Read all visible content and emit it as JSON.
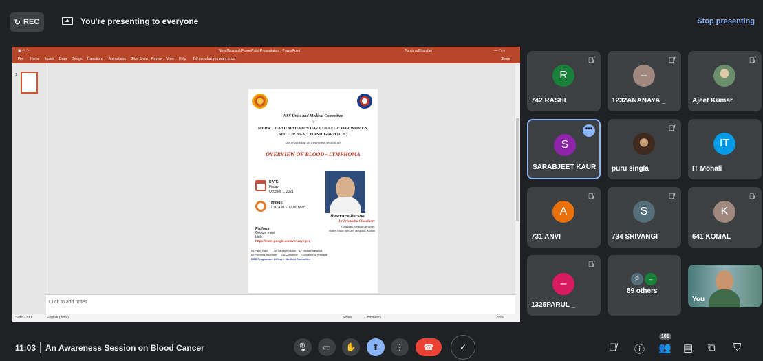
{
  "topbar": {
    "rec_label": "REC",
    "presenting_text": "You're presenting to everyone",
    "stop_label": "Stop presenting"
  },
  "ppt": {
    "window_title": "New Microsoft PowerPoint Presentation - PowerPoint",
    "user_name": "Purnima Bhandari",
    "menu": [
      "File",
      "Home",
      "Insert",
      "Draw",
      "Design",
      "Transitions",
      "Animations",
      "Slide Show",
      "Review",
      "View",
      "Help"
    ],
    "tell_me": "Tell me what you want to do",
    "share": "Share",
    "notes_placeholder": "Click to add notes",
    "status_slide": "Slide 1 of 1",
    "status_lang": "English (India)",
    "status_notes": "Notes",
    "status_comments": "Comments",
    "zoom": "33%"
  },
  "slide": {
    "org": "NSS Units and Medical Committee",
    "of": "of",
    "college": "MEHR CHAND MAHAJAN DAV COLLEGE FOR WOMEN,",
    "sector": "SECTOR 36-A, CHANDIGARH (U.T.)",
    "organising": "are organising an awareness session on",
    "heading": "OVERVIEW OF BLOOD - LYMPHOMA",
    "date_label": "DATE:",
    "date_day": "Friday",
    "date_value": "October 1, 2021",
    "timings_label": "Timings:",
    "timings_value": "11.00 A.M. - 12.00 noon",
    "resource_label": "Resource Person",
    "resource_name": "Dr Priyanshu Choudhary",
    "resource_role": "Consultant Medical Oncology,",
    "resource_org": "Shalby Multi-Specialty Hospitals, Mohali",
    "platform_label": "Platform:",
    "platform_value": "Google meet",
    "link_label": "Link:",
    "link_value": "https://meet.google.com/ver-zeyn-prq",
    "people_line1": "Dr Pallvi Rani        Dr Sarabjeet Kaur    Dr Nisha Bhargava",
    "people_line2": "Dr Purnima Bhandari      Co-Convenor     Convenor & Principal",
    "people_line3": "NSS Programme Officers  Medical Committee"
  },
  "participants": [
    {
      "initial": "R",
      "name": "742 RASHI",
      "color": "#188038"
    },
    {
      "initial": "–",
      "name": "1232ANANAYA _",
      "color": "#a1887f"
    },
    {
      "initial": "",
      "name": "Ajeet Kumar",
      "color": "#6b8e6b"
    },
    {
      "initial": "S",
      "name": "SARABJEET KAUR",
      "color": "#8e24aa"
    },
    {
      "initial": "",
      "name": "puru singla",
      "color": "#5d4037"
    },
    {
      "initial": "IT",
      "name": "IT Mohali",
      "color": "#039be5"
    },
    {
      "initial": "A",
      "name": "731 ANVI",
      "color": "#e8710a"
    },
    {
      "initial": "S",
      "name": "734 SHIVANGI",
      "color": "#546e7a"
    },
    {
      "initial": "K",
      "name": "641 KOMAL",
      "color": "#a1887f"
    },
    {
      "initial": "–",
      "name": "1325PARUL _",
      "color": "#d81b60"
    },
    {
      "initial": "",
      "name": "89 others",
      "color": "#3c4043"
    },
    {
      "initial": "",
      "name": "You",
      "color": "#3c4043"
    }
  ],
  "others_chips": [
    "P",
    "–"
  ],
  "bottombar": {
    "time": "11:03",
    "meeting_name": "An Awareness Session on Blood Cancer",
    "participant_count": "101"
  },
  "colors": {
    "accent": "#8ab4f8",
    "end_call": "#ea4335",
    "ppt_brand": "#b7472a"
  }
}
